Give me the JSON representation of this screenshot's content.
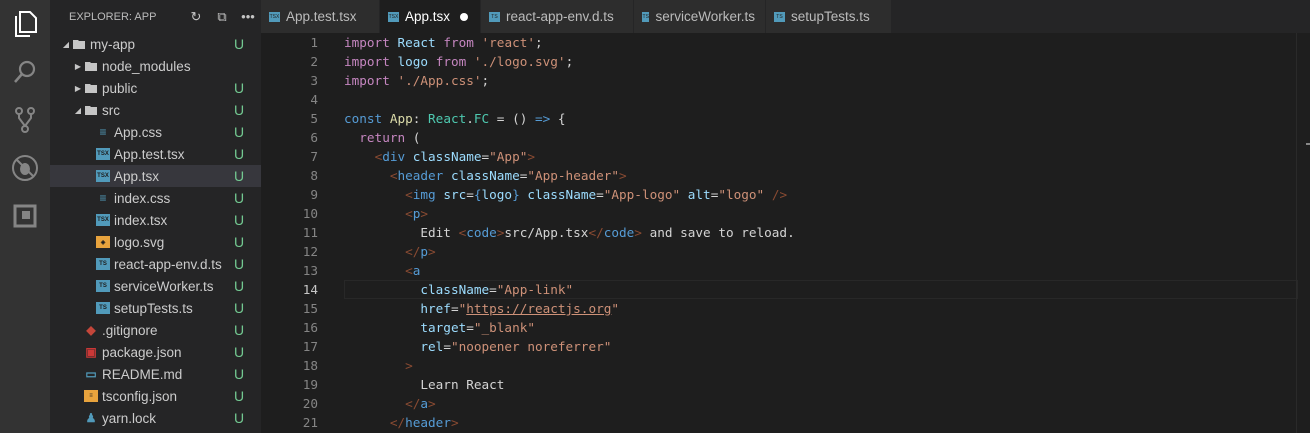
{
  "sidebar": {
    "title": "EXPLORER: APP",
    "icons": [
      "refresh-icon",
      "collapse-all-icon",
      "more-icon"
    ],
    "items": [
      {
        "label": "my-app",
        "type": "folder-open",
        "depth": 0,
        "badge": "U"
      },
      {
        "label": "node_modules",
        "type": "folder-closed",
        "depth": 1,
        "badge": ""
      },
      {
        "label": "public",
        "type": "folder-closed",
        "depth": 1,
        "badge": "U"
      },
      {
        "label": "src",
        "type": "folder-open",
        "depth": 1,
        "badge": "U"
      },
      {
        "label": "App.css",
        "type": "css",
        "depth": 2,
        "badge": "U"
      },
      {
        "label": "App.test.tsx",
        "type": "tsx",
        "depth": 2,
        "badge": "U"
      },
      {
        "label": "App.tsx",
        "type": "tsx",
        "depth": 2,
        "badge": "U",
        "selected": true
      },
      {
        "label": "index.css",
        "type": "css",
        "depth": 2,
        "badge": "U"
      },
      {
        "label": "index.tsx",
        "type": "tsx",
        "depth": 2,
        "badge": "U"
      },
      {
        "label": "logo.svg",
        "type": "svg",
        "depth": 2,
        "badge": "U"
      },
      {
        "label": "react-app-env.d.ts",
        "type": "ts",
        "depth": 2,
        "badge": "U"
      },
      {
        "label": "serviceWorker.ts",
        "type": "ts",
        "depth": 2,
        "badge": "U"
      },
      {
        "label": "setupTests.ts",
        "type": "ts",
        "depth": 2,
        "badge": "U"
      },
      {
        "label": ".gitignore",
        "type": "git",
        "depth": 1,
        "badge": "U"
      },
      {
        "label": "package.json",
        "type": "npm",
        "depth": 1,
        "badge": "U"
      },
      {
        "label": "README.md",
        "type": "md",
        "depth": 1,
        "badge": "U"
      },
      {
        "label": "tsconfig.json",
        "type": "json",
        "depth": 1,
        "badge": "U"
      },
      {
        "label": "yarn.lock",
        "type": "yarn",
        "depth": 1,
        "badge": "U"
      }
    ]
  },
  "tabs": [
    {
      "label": "App.test.tsx",
      "icon": "TSX"
    },
    {
      "label": "App.tsx",
      "icon": "TSX",
      "active": true,
      "dirty": true
    },
    {
      "label": "react-app-env.d.ts",
      "icon": "TS"
    },
    {
      "label": "serviceWorker.ts",
      "icon": "TS"
    },
    {
      "label": "setupTests.ts",
      "icon": "TS"
    }
  ],
  "editor": {
    "current_line": 14,
    "lines": [
      [
        [
          "import",
          "kw"
        ],
        [
          " ",
          "tx"
        ],
        [
          "React",
          "var"
        ],
        [
          " ",
          "tx"
        ],
        [
          "from",
          "kw"
        ],
        [
          " 'react'",
          "str"
        ],
        [
          ";",
          "tx"
        ]
      ],
      [
        [
          "import",
          "kw"
        ],
        [
          " ",
          "tx"
        ],
        [
          "logo",
          "var"
        ],
        [
          " ",
          "tx"
        ],
        [
          "from",
          "kw"
        ],
        [
          " './logo.svg'",
          "str"
        ],
        [
          ";",
          "tx"
        ]
      ],
      [
        [
          "import",
          "kw"
        ],
        [
          " './App.css'",
          "str"
        ],
        [
          ";",
          "tx"
        ]
      ],
      [],
      [
        [
          "const",
          "st"
        ],
        [
          " ",
          "tx"
        ],
        [
          "App",
          "fn"
        ],
        [
          ": ",
          "tx"
        ],
        [
          "React",
          "ty"
        ],
        [
          ".",
          "tx"
        ],
        [
          "FC",
          "ty"
        ],
        [
          " = () ",
          "tx"
        ],
        [
          "=>",
          "st"
        ],
        [
          " {",
          "tx"
        ]
      ],
      [
        [
          "  ",
          "tx"
        ],
        [
          "return",
          "kw"
        ],
        [
          " (",
          "tx"
        ]
      ],
      [
        [
          "    ",
          "tx"
        ],
        [
          "<",
          "br"
        ],
        [
          "div",
          "tag"
        ],
        [
          " ",
          "tx"
        ],
        [
          "className",
          "at"
        ],
        [
          "=",
          "tx"
        ],
        [
          "\"App\"",
          "str"
        ],
        [
          ">",
          "br"
        ]
      ],
      [
        [
          "      ",
          "tx"
        ],
        [
          "<",
          "br"
        ],
        [
          "header",
          "tag"
        ],
        [
          " ",
          "tx"
        ],
        [
          "className",
          "at"
        ],
        [
          "=",
          "tx"
        ],
        [
          "\"App-header\"",
          "str"
        ],
        [
          ">",
          "br"
        ]
      ],
      [
        [
          "        ",
          "tx"
        ],
        [
          "<",
          "br"
        ],
        [
          "img",
          "tag"
        ],
        [
          " ",
          "tx"
        ],
        [
          "src",
          "at"
        ],
        [
          "=",
          "tx"
        ],
        [
          "{",
          "st"
        ],
        [
          "logo",
          "var"
        ],
        [
          "}",
          "st"
        ],
        [
          " ",
          "tx"
        ],
        [
          "className",
          "at"
        ],
        [
          "=",
          "tx"
        ],
        [
          "\"App-logo\"",
          "str"
        ],
        [
          " ",
          "tx"
        ],
        [
          "alt",
          "at"
        ],
        [
          "=",
          "tx"
        ],
        [
          "\"logo\"",
          "str"
        ],
        [
          " />",
          "br"
        ]
      ],
      [
        [
          "        ",
          "tx"
        ],
        [
          "<",
          "br"
        ],
        [
          "p",
          "tag"
        ],
        [
          ">",
          "br"
        ]
      ],
      [
        [
          "          Edit ",
          "tx"
        ],
        [
          "<",
          "br"
        ],
        [
          "code",
          "tag"
        ],
        [
          ">",
          "br"
        ],
        [
          "src/App.tsx",
          "tx"
        ],
        [
          "</",
          "br"
        ],
        [
          "code",
          "tag"
        ],
        [
          ">",
          "br"
        ],
        [
          " and save to reload.",
          "tx"
        ]
      ],
      [
        [
          "        ",
          "tx"
        ],
        [
          "</",
          "br"
        ],
        [
          "p",
          "tag"
        ],
        [
          ">",
          "br"
        ]
      ],
      [
        [
          "        ",
          "tx"
        ],
        [
          "<",
          "br"
        ],
        [
          "a",
          "tag"
        ]
      ],
      [
        [
          "          ",
          "tx"
        ],
        [
          "className",
          "at"
        ],
        [
          "=",
          "tx"
        ],
        [
          "\"App-link\"",
          "str"
        ]
      ],
      [
        [
          "          ",
          "tx"
        ],
        [
          "href",
          "at"
        ],
        [
          "=",
          "tx"
        ],
        [
          "\"",
          "str"
        ],
        [
          "https://reactjs.org",
          "str ul"
        ],
        [
          "\"",
          "str"
        ]
      ],
      [
        [
          "          ",
          "tx"
        ],
        [
          "target",
          "at"
        ],
        [
          "=",
          "tx"
        ],
        [
          "\"_blank\"",
          "str"
        ]
      ],
      [
        [
          "          ",
          "tx"
        ],
        [
          "rel",
          "at"
        ],
        [
          "=",
          "tx"
        ],
        [
          "\"noopener noreferrer\"",
          "str"
        ]
      ],
      [
        [
          "        ",
          "tx"
        ],
        [
          ">",
          "br"
        ]
      ],
      [
        [
          "          Learn React",
          "tx"
        ]
      ],
      [
        [
          "        ",
          "tx"
        ],
        [
          "</",
          "br"
        ],
        [
          "a",
          "tag"
        ],
        [
          ">",
          "br"
        ]
      ],
      [
        [
          "      ",
          "tx"
        ],
        [
          "</",
          "br"
        ],
        [
          "header",
          "tag"
        ],
        [
          ">",
          "br"
        ]
      ]
    ]
  }
}
